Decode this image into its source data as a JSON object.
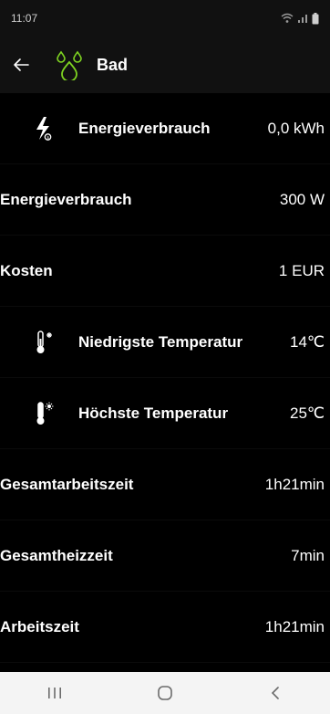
{
  "status_bar": {
    "time": "11:07"
  },
  "header": {
    "title": "Bad",
    "room_icon": "water-drops-icon"
  },
  "rows": [
    {
      "label": "Energieverbrauch",
      "value": "0,0 kWh",
      "icon": "energy-bolt-icon"
    },
    {
      "label": "Energieverbrauch",
      "value": "300 W"
    },
    {
      "label": "Kosten",
      "value": "1 EUR"
    },
    {
      "label": "Niedrigste Temperatur",
      "value": "14℃",
      "icon": "thermometer-cold-icon"
    },
    {
      "label": "Höchste Temperatur",
      "value": "25℃",
      "icon": "thermometer-hot-icon"
    },
    {
      "label": "Gesamtarbeitszeit",
      "value": "1h21min"
    },
    {
      "label": "Gesamtheizzeit",
      "value": "7min"
    },
    {
      "label": "Arbeitszeit",
      "value": "1h21min"
    }
  ],
  "colors": {
    "accent_green": "#7ed321",
    "background": "#000000",
    "header": "#111111",
    "nav_bar": "#f4f4f4"
  }
}
